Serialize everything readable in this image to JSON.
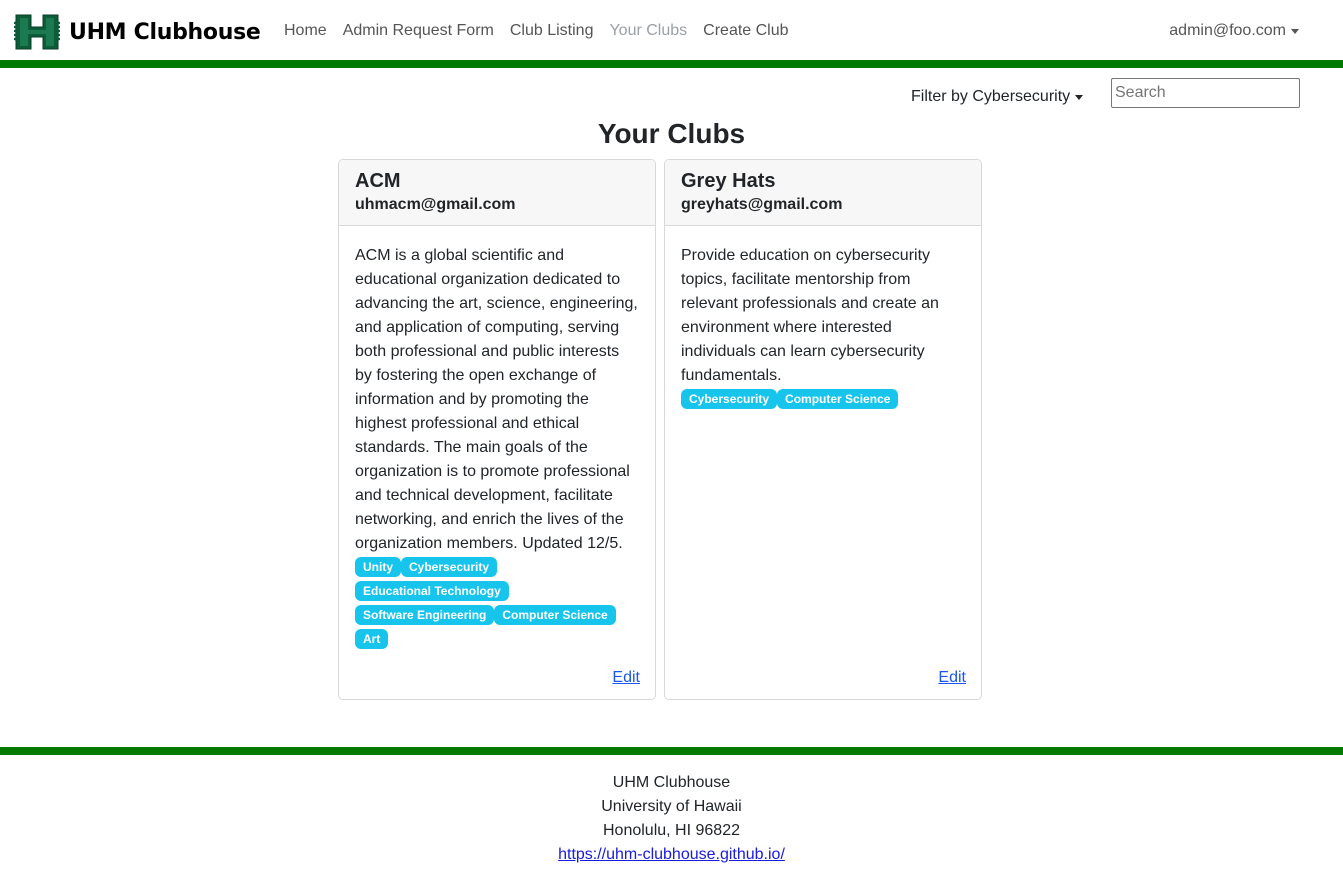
{
  "brand": {
    "name": "UHM Clubhouse",
    "logo_icon": "hawaii-h-logo-icon",
    "logo_color": "#0d5c3a"
  },
  "nav": {
    "links": [
      {
        "label": "Home",
        "active": false
      },
      {
        "label": "Admin Request Form",
        "active": false
      },
      {
        "label": "Club Listing",
        "active": false
      },
      {
        "label": "Your Clubs",
        "active": true
      },
      {
        "label": "Create Club",
        "active": false
      }
    ],
    "user": "admin@foo.com"
  },
  "filter": {
    "label": "Filter by Cybersecurity"
  },
  "search": {
    "placeholder": "Search",
    "value": ""
  },
  "page": {
    "title": "Your Clubs"
  },
  "clubs": [
    {
      "name": "ACM",
      "email": "uhmacm@gmail.com",
      "description": "ACM is a global scientific and educational organization dedicated to advancing the art, science, engineering, and application of computing, serving both professional and public interests by fostering the open exchange of information and by promoting the highest professional and ethical standards. The main goals of the organization is to promote professional and technical development, facilitate networking, and enrich the lives of the organization members. Updated 12/5.",
      "tags": [
        "Unity",
        "Cybersecurity",
        "Educational Technology",
        "Software Engineering",
        "Computer Science",
        "Art"
      ],
      "edit_label": "Edit"
    },
    {
      "name": "Grey Hats",
      "email": "greyhats@gmail.com",
      "description": "Provide education on cybersecurity topics, facilitate mentorship from relevant professionals and create an environment where interested individuals can learn cybersecurity fundamentals.",
      "tags": [
        "Cybersecurity",
        "Computer Science"
      ],
      "edit_label": "Edit"
    }
  ],
  "footer": {
    "line1": "UHM Clubhouse",
    "line2": "University of Hawaii",
    "line3": "Honolulu, HI 96822",
    "link": "https://uhm-clubhouse.github.io/"
  },
  "colors": {
    "accent_green": "#027a02",
    "tag_bg": "#17c4ec",
    "link": "#1a57f0"
  }
}
